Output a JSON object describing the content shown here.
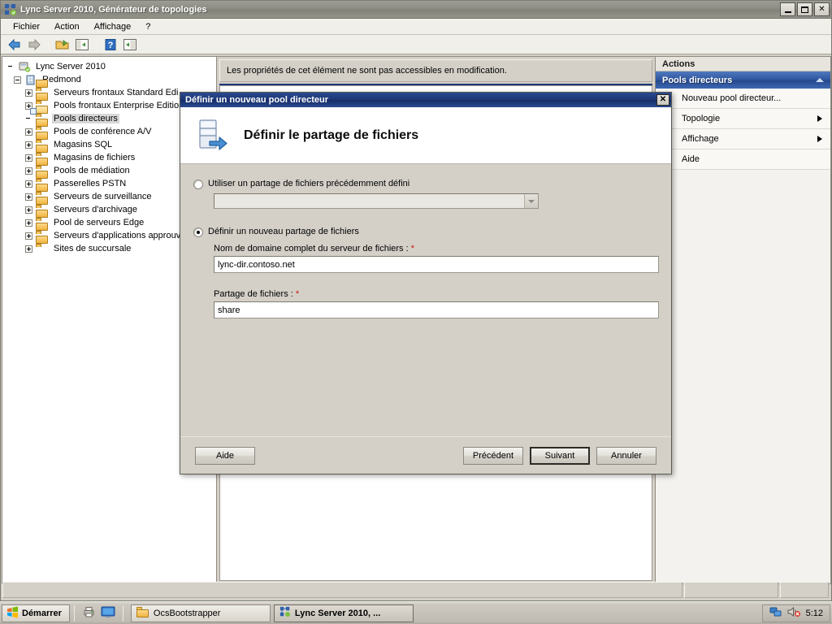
{
  "window": {
    "title": "Lync Server 2010, Générateur de topologies",
    "icon": "lync-topology-builder-icon",
    "controls": {
      "minimize": "_",
      "maximize": "▢",
      "close": "✕"
    }
  },
  "menubar": {
    "items": [
      "Fichier",
      "Action",
      "Affichage",
      "?"
    ]
  },
  "toolbar": {
    "buttons": [
      {
        "name": "back-icon",
        "glyph": "◄"
      },
      {
        "name": "forward-icon",
        "glyph": "►"
      },
      {
        "name": "up-folder-icon",
        "glyph": "▣"
      },
      {
        "name": "show-console-tree-icon",
        "glyph": "▤"
      },
      {
        "name": "help-icon",
        "glyph": "?"
      },
      {
        "name": "show-action-pane-icon",
        "glyph": "▥"
      }
    ]
  },
  "tree": {
    "root": {
      "label": "Lync Server 2010",
      "icon": "lync-server-icon"
    },
    "site": {
      "label": "Redmond",
      "icon": "site-icon"
    },
    "items": [
      {
        "label": "Serveurs frontaux Standard Edi",
        "expandable": true,
        "selected": false
      },
      {
        "label": "Pools frontaux Enterprise Edition",
        "expandable": true,
        "selected": false
      },
      {
        "label": "Pools directeurs",
        "expandable": false,
        "selected": true
      },
      {
        "label": "Pools de conférence A/V",
        "expandable": true,
        "selected": false
      },
      {
        "label": "Magasins SQL",
        "expandable": true,
        "selected": false
      },
      {
        "label": "Magasins de fichiers",
        "expandable": true,
        "selected": false
      },
      {
        "label": "Pools de médiation",
        "expandable": true,
        "selected": false
      },
      {
        "label": "Passerelles PSTN",
        "expandable": true,
        "selected": false
      },
      {
        "label": "Serveurs de surveillance",
        "expandable": true,
        "selected": false
      },
      {
        "label": "Serveurs d'archivage",
        "expandable": true,
        "selected": false
      },
      {
        "label": "Pool de serveurs Edge",
        "expandable": true,
        "selected": false
      },
      {
        "label": "Serveurs d'applications approuv",
        "expandable": true,
        "selected": false
      },
      {
        "label": "Sites de succursale",
        "expandable": true,
        "selected": false
      }
    ]
  },
  "main": {
    "message": "Les propriétés de cet élément ne sont pas accessibles en modification."
  },
  "actions": {
    "header": "Actions",
    "group_title": "Pools directeurs",
    "items": [
      {
        "label": "Nouveau pool directeur...",
        "submenu": false
      },
      {
        "label": "Topologie",
        "submenu": true
      },
      {
        "label": "Affichage",
        "submenu": true
      },
      {
        "label": "Aide",
        "submenu": false
      }
    ]
  },
  "statusbar": {
    "cell1": "",
    "cell2": "",
    "cell3": ""
  },
  "dialog": {
    "title": "Définir un nouveau pool directeur",
    "close_label": "✕",
    "heading": "Définir le partage de fichiers",
    "heading_icon": "file-share-server-icon",
    "option_existing": {
      "label": "Utiliser un partage de fichiers précédemment défini",
      "selected": false,
      "combo_value": "",
      "combo_placeholder": ""
    },
    "option_new": {
      "label": "Définir un nouveau partage de fichiers",
      "selected": true
    },
    "fqdn_field": {
      "label": "Nom de domaine complet du serveur de fichiers :",
      "required_marker": "*",
      "value": "lync-dir.contoso.net"
    },
    "share_field": {
      "label": "Partage de fichiers :",
      "required_marker": "*",
      "value": "share"
    },
    "buttons": {
      "help": "Aide",
      "back": "Précédent",
      "next": "Suivant",
      "cancel": "Annuler"
    }
  },
  "taskbar": {
    "start": "Démarrer",
    "quick_launch": [
      {
        "name": "network-printer-icon"
      },
      {
        "name": "show-desktop-icon"
      }
    ],
    "tasks": [
      {
        "label": "OcsBootstrapper",
        "icon": "folder-icon",
        "active": false
      },
      {
        "label": "Lync Server 2010, ...",
        "icon": "lync-topology-builder-icon",
        "active": true
      }
    ],
    "tray": {
      "icons": [
        {
          "name": "network-icon"
        },
        {
          "name": "volume-muted-icon"
        }
      ],
      "clock": "5:12"
    }
  },
  "colors": {
    "title_bar": "#8d8d84",
    "dialog_title_bar": "#1c3575",
    "action_group": "#2f56a0",
    "accent_line": "#1d3a7a",
    "required_star": "#d01414",
    "face": "#d4d0c8"
  }
}
